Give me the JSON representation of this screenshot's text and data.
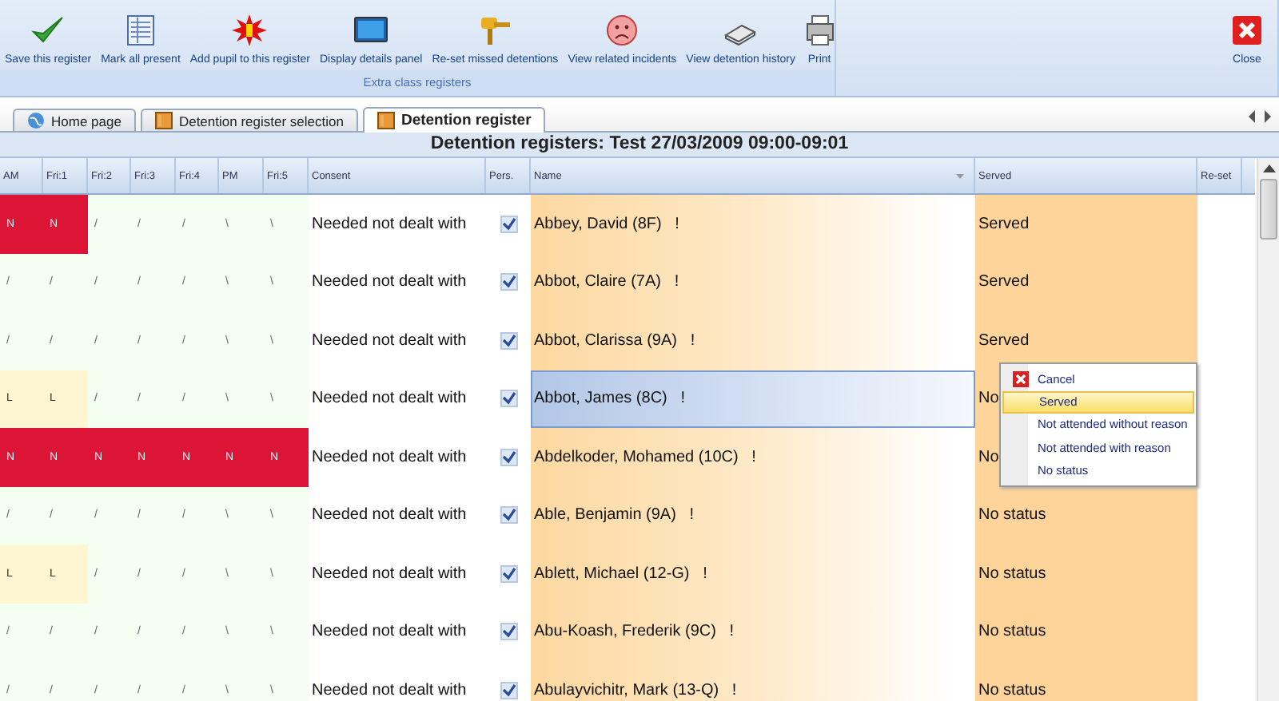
{
  "toolbar": {
    "buttons": [
      {
        "label": "Save this register"
      },
      {
        "label": "Mark all present"
      },
      {
        "label": "Add pupil to this register"
      },
      {
        "label": "Display details panel"
      },
      {
        "label": "Re-set missed detentions"
      },
      {
        "label": "View related incidents"
      },
      {
        "label": "View detention history"
      },
      {
        "label": "Print"
      }
    ],
    "group_label": "Extra class registers",
    "close_button": {
      "label": "Close"
    }
  },
  "tabs": [
    {
      "label": "Home page",
      "selected": false
    },
    {
      "label": "Detention register selection",
      "selected": false
    },
    {
      "label": "Detention register",
      "selected": true
    }
  ],
  "title": "Detention registers: Test 27/03/2009 09:00-09:01",
  "table": {
    "columns": [
      "AM",
      "Fri:1",
      "Fri:2",
      "Fri:3",
      "Fri:4",
      "PM",
      "Fri:5",
      "Consent",
      "Pers.",
      "Name",
      "Served",
      "Re-set"
    ],
    "rows": [
      {
        "marks": [
          {
            "text": "N",
            "kind": "absent"
          },
          {
            "text": "N",
            "kind": "absent"
          },
          {
            "text": "/",
            "kind": "present"
          },
          {
            "text": "/",
            "kind": "present"
          },
          {
            "text": "/",
            "kind": "present"
          },
          {
            "text": "\\",
            "kind": "present"
          },
          {
            "text": "\\",
            "kind": "present"
          }
        ],
        "consent": "Needed not dealt with",
        "pers": true,
        "name": "Abbey, David (8F)   !",
        "served": "Served",
        "selected": false
      },
      {
        "marks": [
          {
            "text": "/",
            "kind": "present"
          },
          {
            "text": "/",
            "kind": "present"
          },
          {
            "text": "/",
            "kind": "present"
          },
          {
            "text": "/",
            "kind": "present"
          },
          {
            "text": "/",
            "kind": "present"
          },
          {
            "text": "\\",
            "kind": "present"
          },
          {
            "text": "\\",
            "kind": "present"
          }
        ],
        "consent": "Needed not dealt with",
        "pers": true,
        "name": "Abbot, Claire (7A)   !",
        "served": "Served",
        "selected": false
      },
      {
        "marks": [
          {
            "text": "/",
            "kind": "present"
          },
          {
            "text": "/",
            "kind": "present"
          },
          {
            "text": "/",
            "kind": "present"
          },
          {
            "text": "/",
            "kind": "present"
          },
          {
            "text": "/",
            "kind": "present"
          },
          {
            "text": "\\",
            "kind": "present"
          },
          {
            "text": "\\",
            "kind": "present"
          }
        ],
        "consent": "Needed not dealt with",
        "pers": true,
        "name": "Abbot, Clarissa (9A)   !",
        "served": "Served",
        "selected": false
      },
      {
        "marks": [
          {
            "text": "L",
            "kind": "late"
          },
          {
            "text": "L",
            "kind": "late"
          },
          {
            "text": "/",
            "kind": "present"
          },
          {
            "text": "/",
            "kind": "present"
          },
          {
            "text": "/",
            "kind": "present"
          },
          {
            "text": "\\",
            "kind": "present"
          },
          {
            "text": "\\",
            "kind": "present"
          }
        ],
        "consent": "Needed not dealt with",
        "pers": true,
        "name": "Abbot, James (8C)   !",
        "served": "No",
        "selected": true
      },
      {
        "marks": [
          {
            "text": "N",
            "kind": "absent"
          },
          {
            "text": "N",
            "kind": "absent"
          },
          {
            "text": "N",
            "kind": "absent"
          },
          {
            "text": "N",
            "kind": "absent"
          },
          {
            "text": "N",
            "kind": "absent"
          },
          {
            "text": "N",
            "kind": "absent"
          },
          {
            "text": "N",
            "kind": "absent"
          }
        ],
        "consent": "Needed not dealt with",
        "pers": true,
        "name": "Abdelkoder, Mohamed (10C)   !",
        "served": "No",
        "selected": false
      },
      {
        "marks": [
          {
            "text": "/",
            "kind": "present"
          },
          {
            "text": "/",
            "kind": "present"
          },
          {
            "text": "/",
            "kind": "present"
          },
          {
            "text": "/",
            "kind": "present"
          },
          {
            "text": "/",
            "kind": "present"
          },
          {
            "text": "\\",
            "kind": "present"
          },
          {
            "text": "\\",
            "kind": "present"
          }
        ],
        "consent": "Needed not dealt with",
        "pers": true,
        "name": "Able, Benjamin (9A)   !",
        "served": "No status",
        "selected": false
      },
      {
        "marks": [
          {
            "text": "L",
            "kind": "late"
          },
          {
            "text": "L",
            "kind": "late"
          },
          {
            "text": "/",
            "kind": "present"
          },
          {
            "text": "/",
            "kind": "present"
          },
          {
            "text": "/",
            "kind": "present"
          },
          {
            "text": "\\",
            "kind": "present"
          },
          {
            "text": "\\",
            "kind": "present"
          }
        ],
        "consent": "Needed not dealt with",
        "pers": true,
        "name": "Ablett, Michael (12-G)   !",
        "served": "No status",
        "selected": false
      },
      {
        "marks": [
          {
            "text": "/",
            "kind": "present"
          },
          {
            "text": "/",
            "kind": "present"
          },
          {
            "text": "/",
            "kind": "present"
          },
          {
            "text": "/",
            "kind": "present"
          },
          {
            "text": "/",
            "kind": "present"
          },
          {
            "text": "\\",
            "kind": "present"
          },
          {
            "text": "\\",
            "kind": "present"
          }
        ],
        "consent": "Needed not dealt with",
        "pers": true,
        "name": "Abu-Koash, Frederik (9C)   !",
        "served": "No status",
        "selected": false
      },
      {
        "marks": [
          {
            "text": "/",
            "kind": "present"
          },
          {
            "text": "/",
            "kind": "present"
          },
          {
            "text": "/",
            "kind": "present"
          },
          {
            "text": "/",
            "kind": "present"
          },
          {
            "text": "/",
            "kind": "present"
          },
          {
            "text": "\\",
            "kind": "present"
          },
          {
            "text": "\\",
            "kind": "present"
          }
        ],
        "consent": "Needed not dealt with",
        "pers": true,
        "name": "Abulayvichitr, Mark (13-Q)   !",
        "served": "No status",
        "selected": false
      }
    ]
  },
  "context_menu": {
    "items": [
      {
        "label": "Cancel",
        "selected": false
      },
      {
        "label": "Served",
        "selected": true
      },
      {
        "label": "Not attended without reason",
        "selected": false
      },
      {
        "label": "Not attended with reason",
        "selected": false
      },
      {
        "label": "No status",
        "selected": false
      }
    ]
  }
}
